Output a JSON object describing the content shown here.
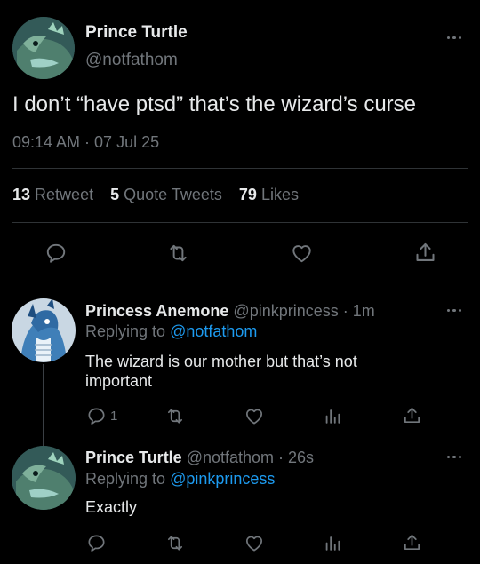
{
  "main_tweet": {
    "author_name": "Prince Turtle",
    "author_handle": "@notfathom",
    "text": "I don’t “have ptsd” that’s the wizard’s curse",
    "timestamp": "09:14 AM · 07 Jul 25",
    "stats": {
      "retweets_count": "13",
      "retweets_label": "Retweet",
      "quotes_count": "5",
      "quotes_label": "Quote Tweets",
      "likes_count": "79",
      "likes_label": "Likes"
    }
  },
  "replies": [
    {
      "author_name": "Princess Anemone",
      "meta": "@pinkprincess · 1m",
      "replying_prefix": "Replying to",
      "replying_handle": "@notfathom",
      "text": "The wizard is our mother but that’s not important",
      "reply_count": "1"
    },
    {
      "author_name": "Prince Turtle",
      "meta": "@notfathom · 26s",
      "replying_prefix": "Replying to",
      "replying_handle": "@pinkprincess",
      "text": "Exactly",
      "reply_count": ""
    }
  ],
  "colors": {
    "background": "#000000",
    "text": "#e7e9ea",
    "muted": "#71767b",
    "link": "#1d9bf0",
    "divider": "#2f3336"
  },
  "icons": [
    "reply-icon",
    "retweet-icon",
    "like-icon",
    "share-icon",
    "analytics-icon",
    "more-icon"
  ]
}
